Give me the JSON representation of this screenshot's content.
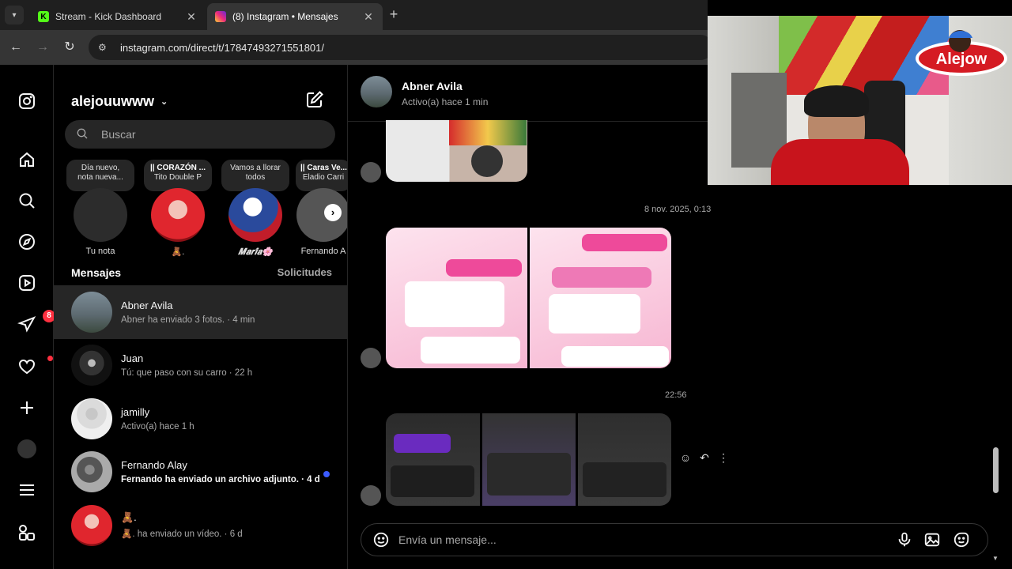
{
  "browser": {
    "tabs": [
      {
        "title": "Stream - Kick Dashboard",
        "favicon": "kick-icon"
      },
      {
        "title": "(8) Instagram • Mensajes",
        "favicon": "instagram-icon"
      }
    ],
    "url": "instagram.com/direct/t/17847493271551801/"
  },
  "rail": {
    "messages_badge": "8"
  },
  "inbox": {
    "username": "alejouuwww",
    "search_placeholder": "Buscar",
    "notes": [
      {
        "bubble_line1": "Día nuevo,",
        "bubble_line2": "nota nueva...",
        "label": "Tu nota"
      },
      {
        "bubble_line1": "|| CORAZÓN ...",
        "bubble_line2": "Tito Double P",
        "label": "🧸."
      },
      {
        "bubble_line1": "Vamos a llorar",
        "bubble_line2": "todos",
        "label": "𝑴𝒂𝒓𝒊́𝒂🌸"
      },
      {
        "bubble_line1": "|| Caras Ve...",
        "bubble_line2": "Eladio Carri",
        "label": "Fernando A"
      }
    ],
    "section_title": "Mensajes",
    "requests_label": "Solicitudes",
    "threads": [
      {
        "name": "Abner Avila",
        "preview": "Abner ha enviado 3 fotos. · 4 min",
        "selected": true,
        "unread": false
      },
      {
        "name": "Juan",
        "preview": "Tú: que paso con su carro · 22 h",
        "selected": false,
        "unread": false
      },
      {
        "name": "jamilly",
        "preview": "Activo(a) hace 1 h",
        "selected": false,
        "unread": false
      },
      {
        "name": "Fernando Alay",
        "preview": "Fernando ha enviado un archivo adjunto. · 4 d",
        "selected": false,
        "unread": true
      },
      {
        "name": "🧸.",
        "preview": "🧸. ha enviado un vídeo. · 6 d",
        "selected": false,
        "unread": false
      }
    ]
  },
  "chat": {
    "contact_name": "Abner Avila",
    "contact_status": "Activo(a) hace 1 min",
    "timestamps": [
      "8 nov. 2025, 0:13",
      "22:56"
    ],
    "composer_placeholder": "Envía un mensaje..."
  },
  "overlay": {
    "streamer_badge": "Alejow"
  },
  "colors": {
    "accent_red": "#ff3040",
    "unread_blue": "#3b5bff",
    "kick_green": "#53fc18"
  }
}
